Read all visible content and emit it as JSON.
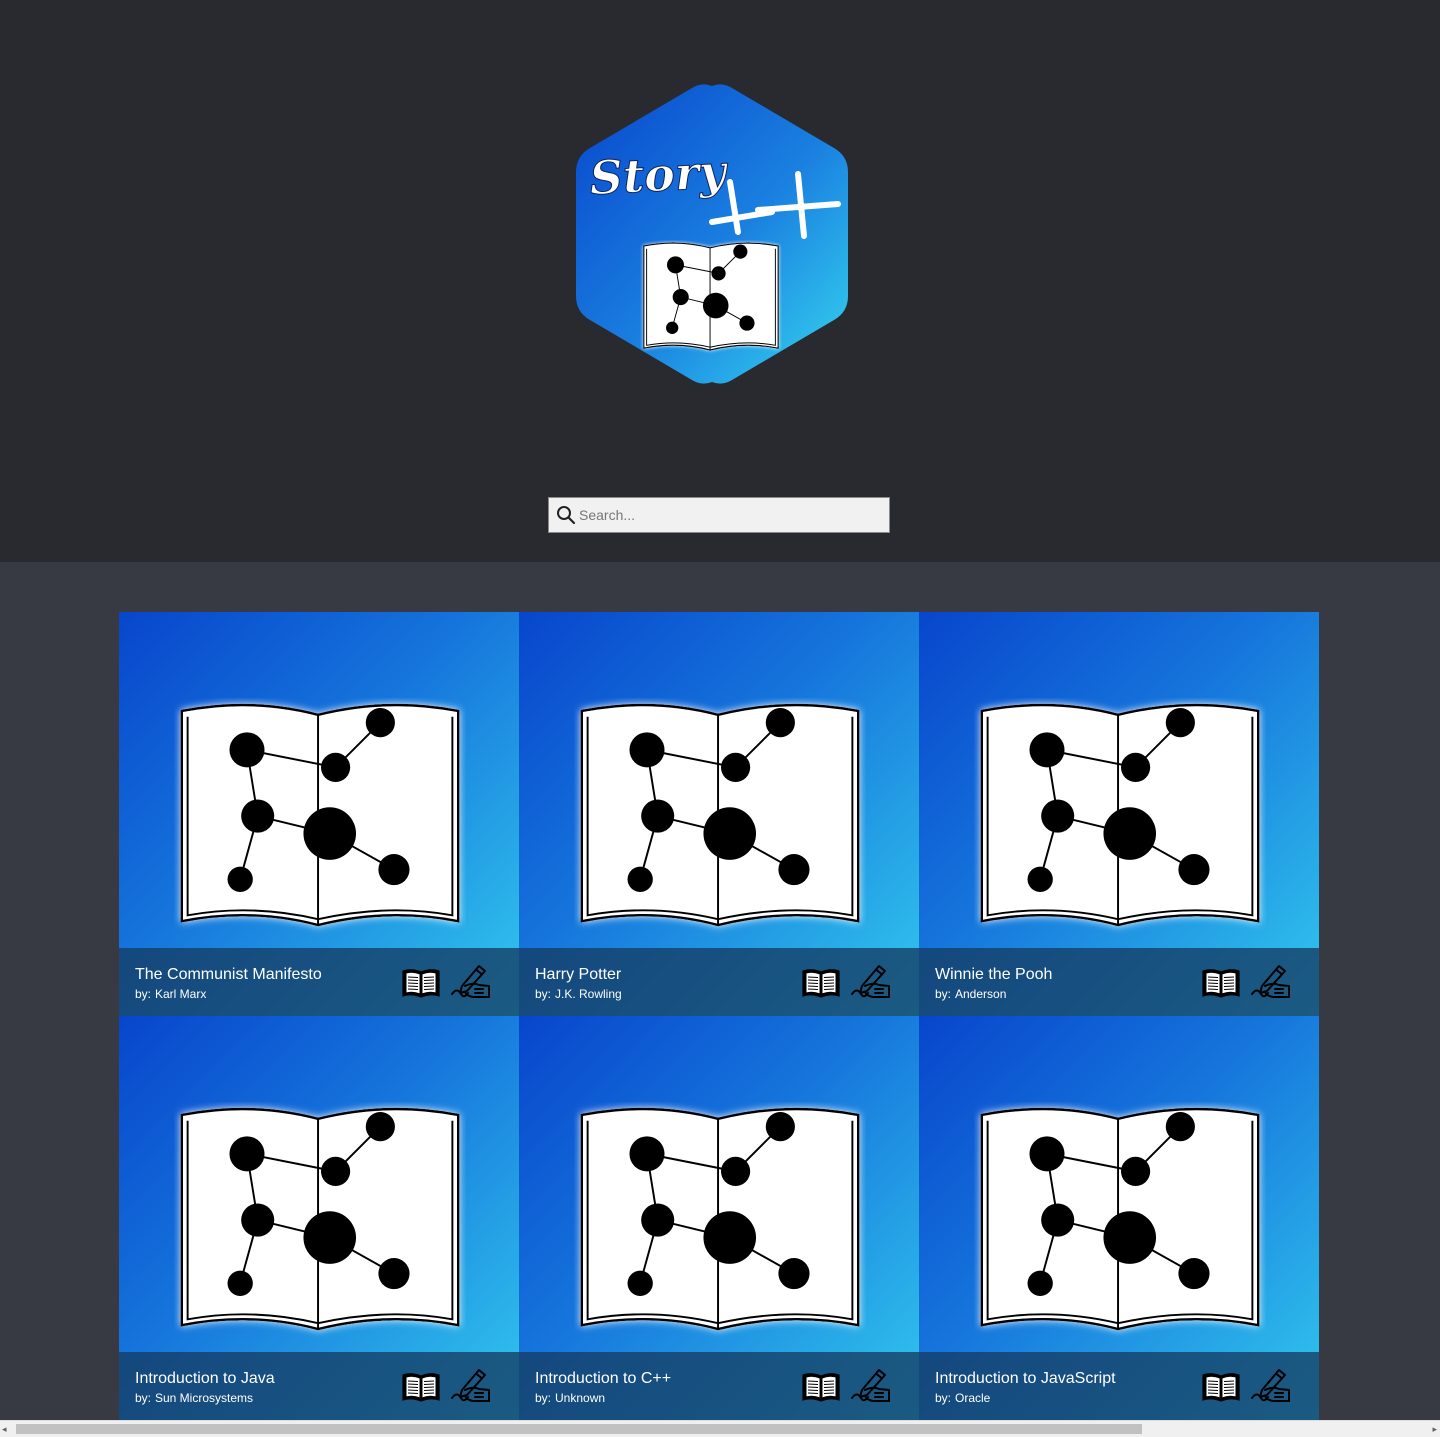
{
  "brand": {
    "logo_text": "Story++",
    "colors": {
      "header_bg": "#282a2f",
      "main_bg": "#383a43",
      "accent": "#1676dc"
    }
  },
  "search": {
    "placeholder": "Search...",
    "icon": "search-icon"
  },
  "library": {
    "author_prefix": "by:",
    "actions": {
      "read_icon": "open-book-icon",
      "edit_icon": "hand-writing-icon"
    },
    "books": [
      {
        "title": "The Communist Manifesto",
        "author": "Karl Marx"
      },
      {
        "title": "Harry Potter",
        "author": "J.K. Rowling"
      },
      {
        "title": "Winnie the Pooh",
        "author": "Anderson"
      },
      {
        "title": "Introduction to Java",
        "author": "Sun Microsystems"
      },
      {
        "title": "Introduction to C++",
        "author": "Unknown"
      },
      {
        "title": "Introduction to JavaScript",
        "author": "Oracle"
      }
    ]
  },
  "scrollbar": {
    "left_arrow": "◂",
    "right_arrow": "▸"
  }
}
